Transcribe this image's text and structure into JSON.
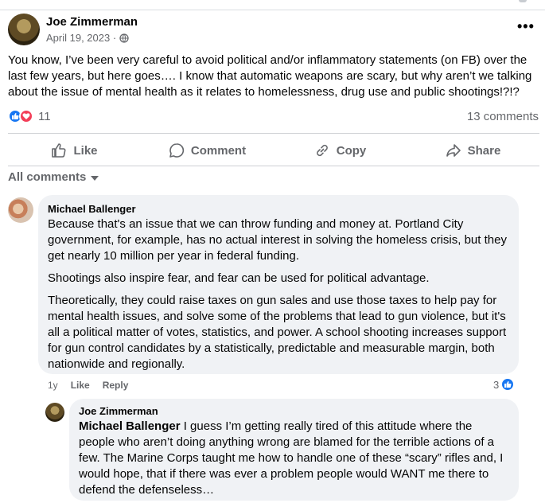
{
  "post": {
    "author": "Joe Zimmerman",
    "date": "April 19, 2023 ·",
    "audience_icon": "globe-icon",
    "text": "You know, I’ve been very careful to avoid political and/or inflammatory statements (on FB) over the last few years, but here goes…. I know that automatic weapons are scary, but why aren’t we talking about the issue of mental health as it relates to homelessness, drug use and public shootings!?!?",
    "reaction_count": "11",
    "comments_count": "13 comments"
  },
  "actions": {
    "like": "Like",
    "comment": "Comment",
    "copy": "Copy",
    "share": "Share"
  },
  "filter": {
    "label": "All comments"
  },
  "comments": [
    {
      "author": "Michael Ballenger",
      "paragraphs": [
        "Because that's an issue that we can throw funding and money at. Portland City government, for example, has no actual interest in solving the homeless crisis, but they get nearly 10 million per year in federal funding.",
        "Shootings also inspire fear, and fear can be used for political advantage.",
        "Theoretically, they could raise taxes on gun sales and use those taxes to help pay for mental health issues, and solve some of the problems that lead to gun violence, but it's all a political matter of votes, statistics, and power. A school shooting increases support for gun control candidates by a statistically, predictable and measurable margin, both nationwide and regionally."
      ],
      "age": "1y",
      "like_label": "Like",
      "reply_label": "Reply",
      "likes": "3"
    },
    {
      "author": "Joe Zimmerman",
      "mention": "Michael Ballenger",
      "text": " I guess I’m getting really tired of this attitude where the people who aren’t doing anything wrong are blamed for the terrible actions of a few. The Marine Corps taught me how to handle one of these “scary” rifles and, I would hope, that if there was ever a problem people would WANT me there to defend the defenseless…"
    }
  ],
  "colors": {
    "accent": "#1877f2",
    "love": "#f33e58",
    "secondary_text": "#65676b",
    "bubble": "#f0f2f5"
  }
}
